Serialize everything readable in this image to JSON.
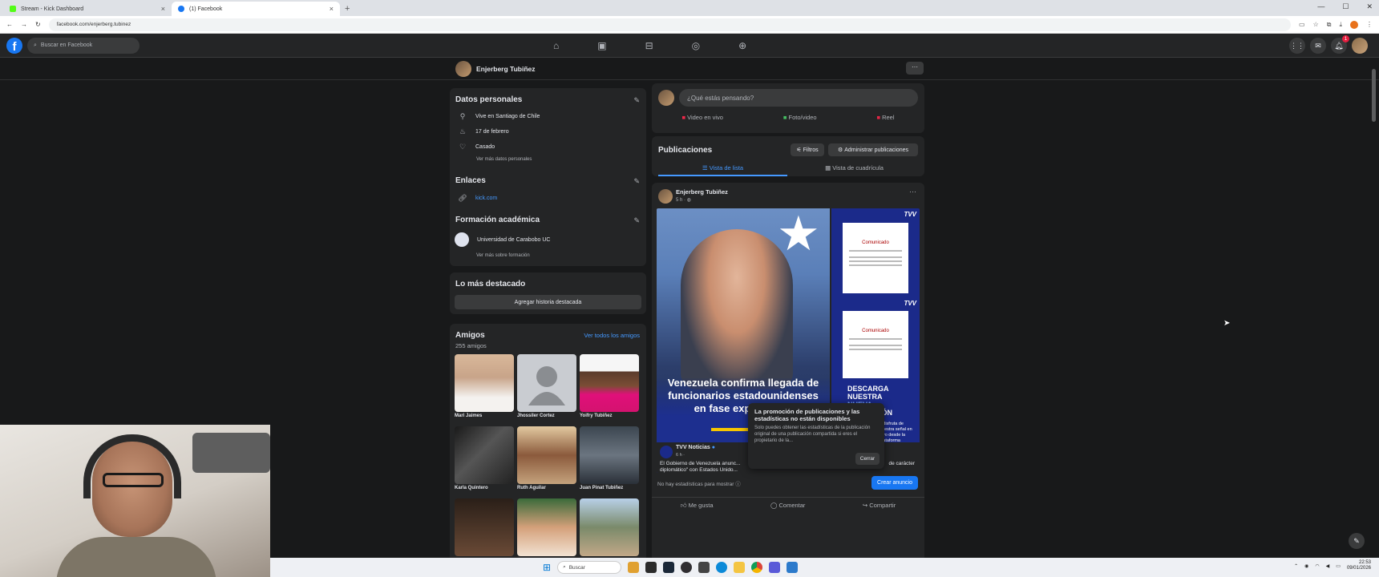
{
  "browser": {
    "tabs": [
      {
        "label": "Stream - Kick Dashboard",
        "favicon_color": "#53fc18"
      },
      {
        "label": "(1) Facebook",
        "favicon_color": "#1877f2"
      }
    ],
    "url": "facebook.com/enjerberg.tubinez"
  },
  "fbnav": {
    "logo": "f",
    "search_placeholder": "Buscar en Facebook",
    "notification_count": "1"
  },
  "profile": {
    "name": "Enjerberg Tubiñez"
  },
  "personal": {
    "title": "Datos personales",
    "items": [
      {
        "icon": "location-icon",
        "text": "Vive en Santiago de Chile"
      },
      {
        "icon": "birthday-icon",
        "text": "17 de febrero"
      },
      {
        "icon": "heart-icon",
        "text": "Casado"
      }
    ],
    "more": "Ver más datos personales"
  },
  "links": {
    "title": "Enlaces",
    "items": [
      {
        "text": "kick.com"
      }
    ]
  },
  "education": {
    "title": "Formación académica",
    "school": "Universidad de Carabobo UC",
    "more": "Ver más sobre formación"
  },
  "featured": {
    "title": "Lo más destacado",
    "button": "Agregar historia destacada"
  },
  "friends": {
    "title": "Amigos",
    "count": "255 amigos",
    "see_all": "Ver todos los amigos",
    "items": [
      {
        "name": "Mari Jaimes",
        "color": "#c8a489"
      },
      {
        "name": "Jhossiler Cortez",
        "color": "#c9ccd1"
      },
      {
        "name": "Yoifry Tubiñez",
        "color": "#f2f2f2"
      },
      {
        "name": "Karla Quintero",
        "color": "#3a3a3a"
      },
      {
        "name": "Ruth Aguilar",
        "color": "#6b4a34"
      },
      {
        "name": "Juan Pinat Tubiñez",
        "color": "#4b5560"
      },
      {
        "name": "",
        "color": "#4a3a2e"
      },
      {
        "name": "",
        "color": "#8c5a3c"
      },
      {
        "name": "",
        "color": "#7a8a6a"
      }
    ]
  },
  "composer": {
    "placeholder": "¿Qué estás pensando?",
    "actions": [
      {
        "label": "Video en vivo",
        "color": "#f02849"
      },
      {
        "label": "Foto/video",
        "color": "#45bd62"
      },
      {
        "label": "Reel",
        "color": "#e42645"
      }
    ]
  },
  "publications": {
    "title": "Publicaciones",
    "filters": "Filtros",
    "manage": "Administrar publicaciones",
    "list_view": "Vista de lista",
    "grid_view": "Vista de cuadrícula"
  },
  "post": {
    "author": "Enjerberg Tubiñez",
    "time": "5 h ·",
    "headline": "Venezuela confirma llegada de funcionarios estadounidenses en fase exploratoria",
    "side_brand": "TVV",
    "side_doc": "Comunicado",
    "promo_lines": [
      "DESCARGA",
      "NUESTRA",
      "NUEVA",
      "APLICACIÓN"
    ],
    "promo_sub": "y disfruta de nuestra señal en vivo desde la plataforma",
    "shared_source": "TVV Noticias",
    "shared_time": "6 h ·",
    "shared_text": "El Gobierno de Venezuela anunc... diplomático\" con Estados Unido...",
    "shared_tail": "de carácter",
    "tooltip_title": "La promoción de publicaciones y las estadísticas no están disponibles",
    "tooltip_body": "Solo puedes obtener las estadísticas de la publicación original de una publicación compartida si eres el propietario de la...",
    "tooltip_close": "Cerrar",
    "stats": "No hay estadísticas para mostrar",
    "create_ad": "Crear anuncio",
    "like": "Me gusta",
    "comment": "Comentar",
    "share": "Compartir"
  },
  "taskbar": {
    "search": "Buscar",
    "clock": "22:53",
    "date": "09/01/2026"
  }
}
